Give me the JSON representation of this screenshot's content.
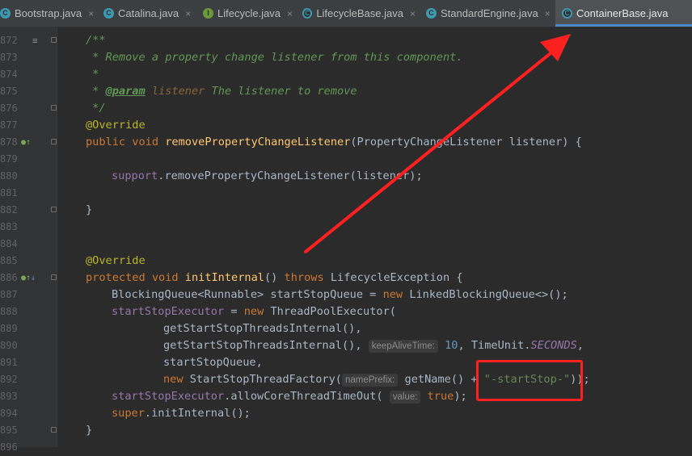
{
  "tabs": [
    {
      "label": "Bootstrap.java",
      "icon": "class-icon",
      "letter": "C"
    },
    {
      "label": "Catalina.java",
      "icon": "class-icon",
      "letter": "C"
    },
    {
      "label": "Lifecycle.java",
      "icon": "interface-icon",
      "letter": "I"
    },
    {
      "label": "LifecycleBase.java",
      "icon": "abstract-class-icon",
      "letter": "C"
    },
    {
      "label": "StandardEngine.java",
      "icon": "class-icon",
      "letter": "C"
    },
    {
      "label": "ContainerBase.java",
      "icon": "abstract-class-icon",
      "letter": "C",
      "active": true
    }
  ],
  "close_glyph": "×",
  "line_numbers": [
    "872",
    "873",
    "874",
    "875",
    "876",
    "877",
    "878",
    "879",
    "880",
    "881",
    "882",
    "883",
    "884",
    "885",
    "886",
    "887",
    "888",
    "889",
    "890",
    "891",
    "892",
    "893",
    "894",
    "895",
    "896"
  ],
  "code": {
    "l872_doc_open": "/**",
    "l873_doc": " * Remove a property change listener from this component.",
    "l874_doc": " *",
    "l875_star": " * ",
    "l875_tag": "@param",
    "l875_param": "listener",
    "l875_rest": " The listener to remove",
    "l876_doc_close": " */",
    "l877_ann": "@Override",
    "l878_kw": "public void ",
    "l878_fn": "removePropertyChangeListener",
    "l878_rest": "(PropertyChangeListener listener) {",
    "l880_field": "support",
    "l880_rest": ".removePropertyChangeListener(listener);",
    "l882_brace": "}",
    "l885_ann": "@Override",
    "l886_kw": "protected void ",
    "l886_fn": "initInternal",
    "l886_mid": "() ",
    "l886_kw2": "throws ",
    "l886_rest": "LifecycleException {",
    "l887_a": "BlockingQueue<Runnable> startStopQueue = ",
    "l887_kw": "new ",
    "l887_b": "LinkedBlockingQueue<>();",
    "l888_field": "startStopExecutor",
    "l888_a": " = ",
    "l888_kw": "new ",
    "l888_b": "ThreadPoolExecutor(",
    "l889": "getStartStopThreadsInternal(),",
    "l890_a": "getStartStopThreadsInternal(),",
    "l890_hint": "keepAliveTime:",
    "l890_num": "10",
    "l890_b": ", TimeUnit.",
    "l890_const": "SECONDS",
    "l890_c": ",",
    "l891": "startStopQueue,",
    "l892_kw": "new ",
    "l892_a": "StartStopThreadFactory(",
    "l892_hint": "namePrefix:",
    "l892_b": "getName() + ",
    "l892_str": "\"-startStop-\"",
    "l892_c": "));",
    "l893_field": "startStopExecutor",
    "l893_a": ".allowCoreThreadTimeOut(",
    "l893_hint": "value:",
    "l893_kw": "true",
    "l893_b": ");",
    "l894_kw": "super",
    "l894_a": ".initInternal();",
    "l895_brace": "}"
  },
  "annotation_color": "#ff2020"
}
